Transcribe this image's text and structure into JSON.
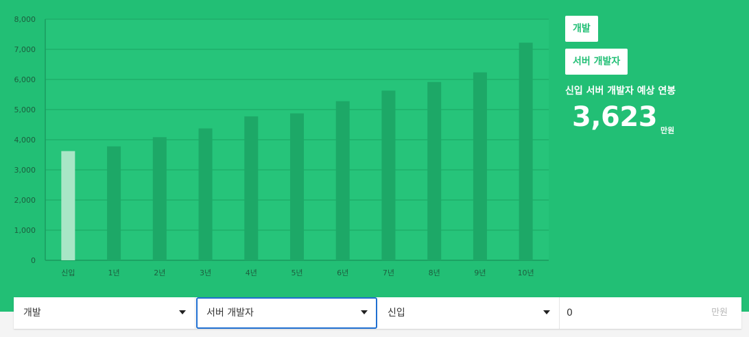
{
  "chart_data": {
    "type": "bar",
    "categories": [
      "신입",
      "1년",
      "2년",
      "3년",
      "4년",
      "5년",
      "6년",
      "7년",
      "8년",
      "9년",
      "10년"
    ],
    "values": [
      3623,
      3780,
      4085,
      4375,
      4775,
      4875,
      5280,
      5630,
      5915,
      6235,
      7220
    ],
    "highlight_index": 0,
    "yticks": [
      "0",
      "1,000",
      "2,000",
      "3,000",
      "4,000",
      "5,000",
      "6,000",
      "7,000",
      "8,000"
    ],
    "ylim": [
      0,
      8000
    ],
    "grid": true,
    "colors": {
      "bar": "#1da867",
      "bar_highlight": "#a8e6c6",
      "grid": "#1fae6b",
      "plot_bg": "#26c47a"
    }
  },
  "side": {
    "job_group_chip": "개발",
    "job_chip": "서버 개발자",
    "caption": "신입 서버 개발자 예상 연봉",
    "salary_value": "3,623",
    "salary_unit": "만원"
  },
  "controls": {
    "job_group": "개발",
    "job": "서버 개발자",
    "experience": "신입",
    "current_salary": "0",
    "current_salary_unit": "만원"
  },
  "colors": {
    "brand": "#22bf75",
    "focus": "#1f6fd1"
  }
}
